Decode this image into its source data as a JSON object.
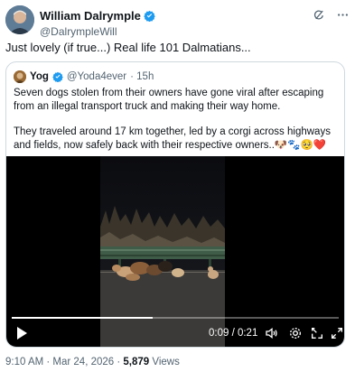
{
  "tweet": {
    "author_name": "William Dalrymple",
    "author_handle": "@DalrympleWill",
    "text": "Just lovely (if true...) Real life 101 Dalmatians...",
    "timestamp": "9:10 AM · Mar 24, 2026 · ",
    "views_count": "5,879",
    "views_label": " Views"
  },
  "quote": {
    "author_name": "Yog",
    "author_handle": "@Yoda4ever",
    "age": "· 15h",
    "paragraph1": "Seven dogs stolen from their owners have gone viral after escaping from an illegal transport truck and making their way home.",
    "paragraph2": "They traveled around 17 km together, led by a corgi across highways and fields, now safely back with their respective owners..",
    "emojis": "🐶🐾🥺❤️"
  },
  "video": {
    "time": "0:09 / 0:21",
    "progress": 0.43
  },
  "icons": {
    "header": [
      "grok-icon",
      "more-icon"
    ],
    "controls": [
      "play-icon",
      "volume-icon",
      "settings-icon",
      "pip-icon",
      "fullscreen-icon"
    ]
  },
  "colors": {
    "verified": "#1d9bf0",
    "secondary_text": "#536471",
    "border": "#cfd9de"
  }
}
